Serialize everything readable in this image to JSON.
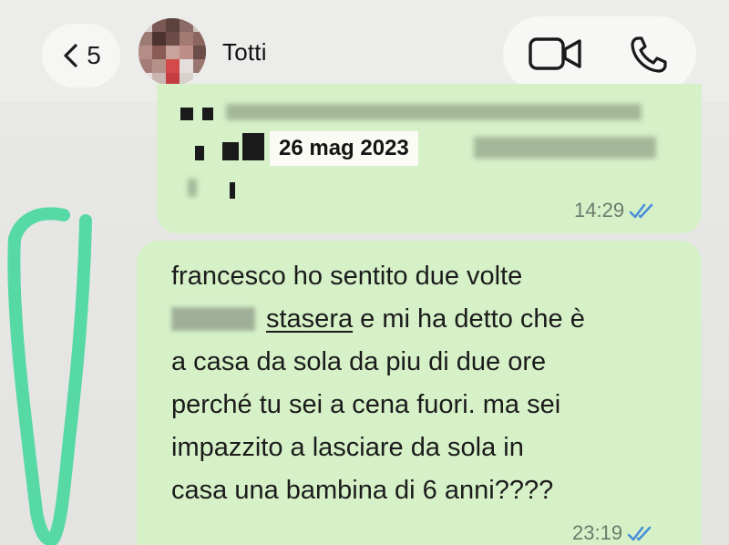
{
  "header": {
    "back_count": "5",
    "contact_name": "Totti",
    "icons": [
      "chevron-left-icon",
      "video-camera-icon",
      "phone-icon"
    ]
  },
  "quoted_message": {
    "date_label": "26 mag 2023",
    "time": "14:29"
  },
  "message": {
    "lines": [
      "francesco ho sentito due volte",
      "stasera e mi ha detto che è",
      "a casa da sola da piu di due ore",
      "perché tu sei a cena fuori. ma sei",
      "impazzito a lasciare da sola in",
      "casa una bambina di 6 anni????"
    ],
    "time": "23:19"
  },
  "colors": {
    "bubble": "#d6f1c8",
    "ticks": "#4a90d9",
    "annotation": "#56d9a5"
  }
}
